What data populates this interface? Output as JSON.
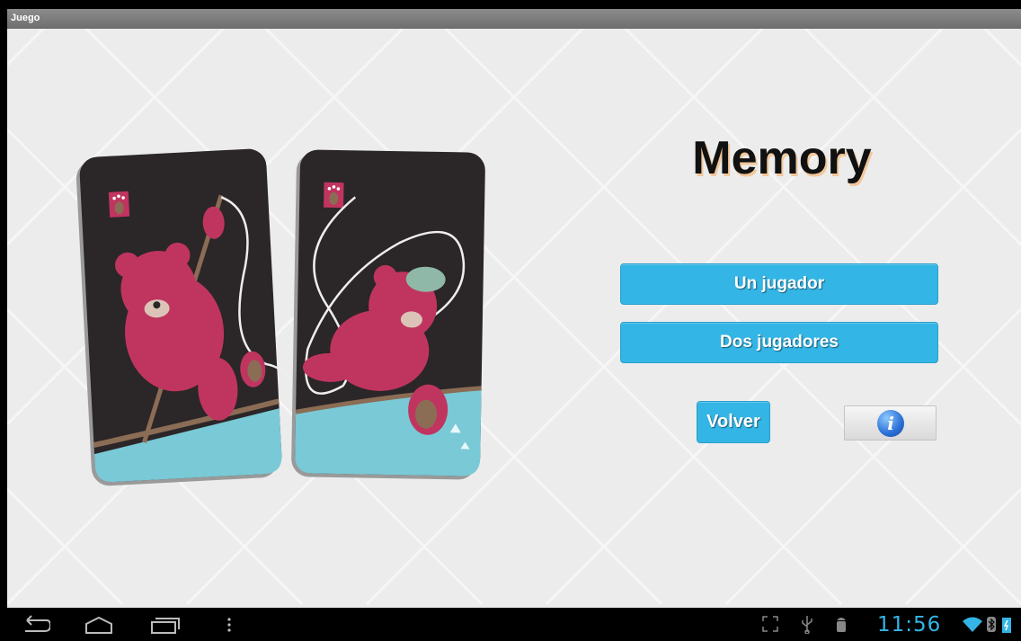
{
  "window": {
    "title": "Juego"
  },
  "main": {
    "game_title": "Memory",
    "buttons": {
      "one_player": "Un jugador",
      "two_players": "Dos jugadores",
      "back": "Volver",
      "info_icon": "info-icon"
    },
    "cards": [
      {
        "name": "card-bear-climbing",
        "icon": "paw-icon"
      },
      {
        "name": "card-bear-falling",
        "icon": "paw-icon"
      }
    ]
  },
  "system_bar": {
    "nav": [
      "back-icon",
      "home-icon",
      "recent-apps-icon",
      "menu-icon"
    ],
    "status": [
      "fullscreen-icon",
      "usb-icon",
      "android-debug-icon",
      "wifi-icon",
      "bluetooth-icon",
      "battery-icon"
    ],
    "time": "11:56"
  },
  "colors": {
    "accent": "#33b5e5",
    "background": "#ececec",
    "bear": "#c0355f",
    "card": "#2b2628"
  }
}
